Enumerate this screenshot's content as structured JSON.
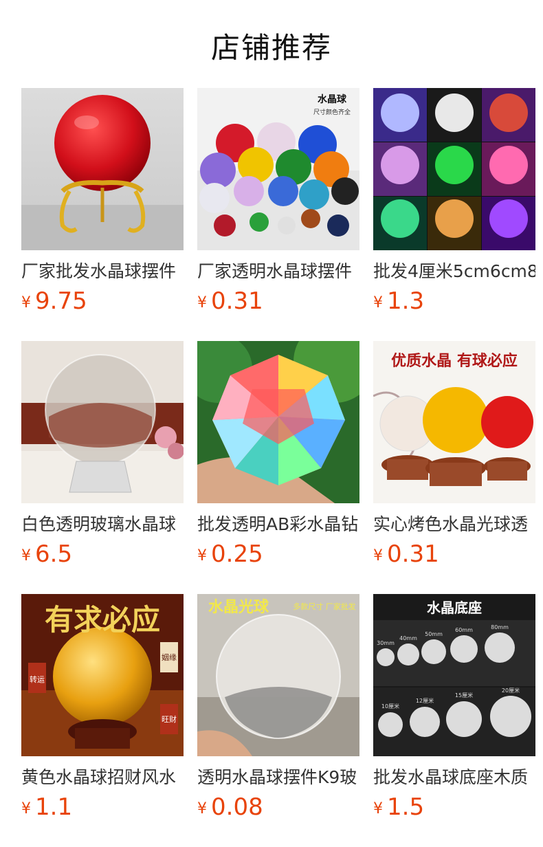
{
  "header": {
    "title": "店铺推荐"
  },
  "products": [
    {
      "name": "厂家批发水晶球摆件",
      "currency": "¥",
      "price": "9.75",
      "image_label": ""
    },
    {
      "name": "厂家透明水晶球摆件",
      "currency": "¥",
      "price": "0.31",
      "image_label": "水晶球",
      "image_sublabel": "尺寸颜色齐全"
    },
    {
      "name": "批发4厘米5cm6cm8",
      "currency": "¥",
      "price": "1.3",
      "image_label": ""
    },
    {
      "name": "白色透明玻璃水晶球",
      "currency": "¥",
      "price": "6.5",
      "image_label": ""
    },
    {
      "name": "批发透明AB彩水晶钻",
      "currency": "¥",
      "price": "0.25",
      "image_label": ""
    },
    {
      "name": "实心烤色水晶光球透",
      "currency": "¥",
      "price": "0.31",
      "image_label": "优质水晶 有球必应"
    },
    {
      "name": "黄色水晶球招财风水",
      "currency": "¥",
      "price": "1.1",
      "image_label": "有求必应",
      "image_tags": [
        "转运",
        "姻缘",
        "旺财"
      ]
    },
    {
      "name": "透明水晶球摆件K9玻",
      "currency": "¥",
      "price": "0.08",
      "image_label": "水晶光球",
      "image_sublabel": "多款尺寸 厂家批发"
    },
    {
      "name": "批发水晶球底座木质",
      "currency": "¥",
      "price": "1.5",
      "image_label": "水晶底座",
      "image_tags": [
        "30mm",
        "40mm",
        "50mm",
        "60mm",
        "80mm",
        "10厘米",
        "12厘米",
        "15厘米",
        "20厘米"
      ]
    }
  ]
}
